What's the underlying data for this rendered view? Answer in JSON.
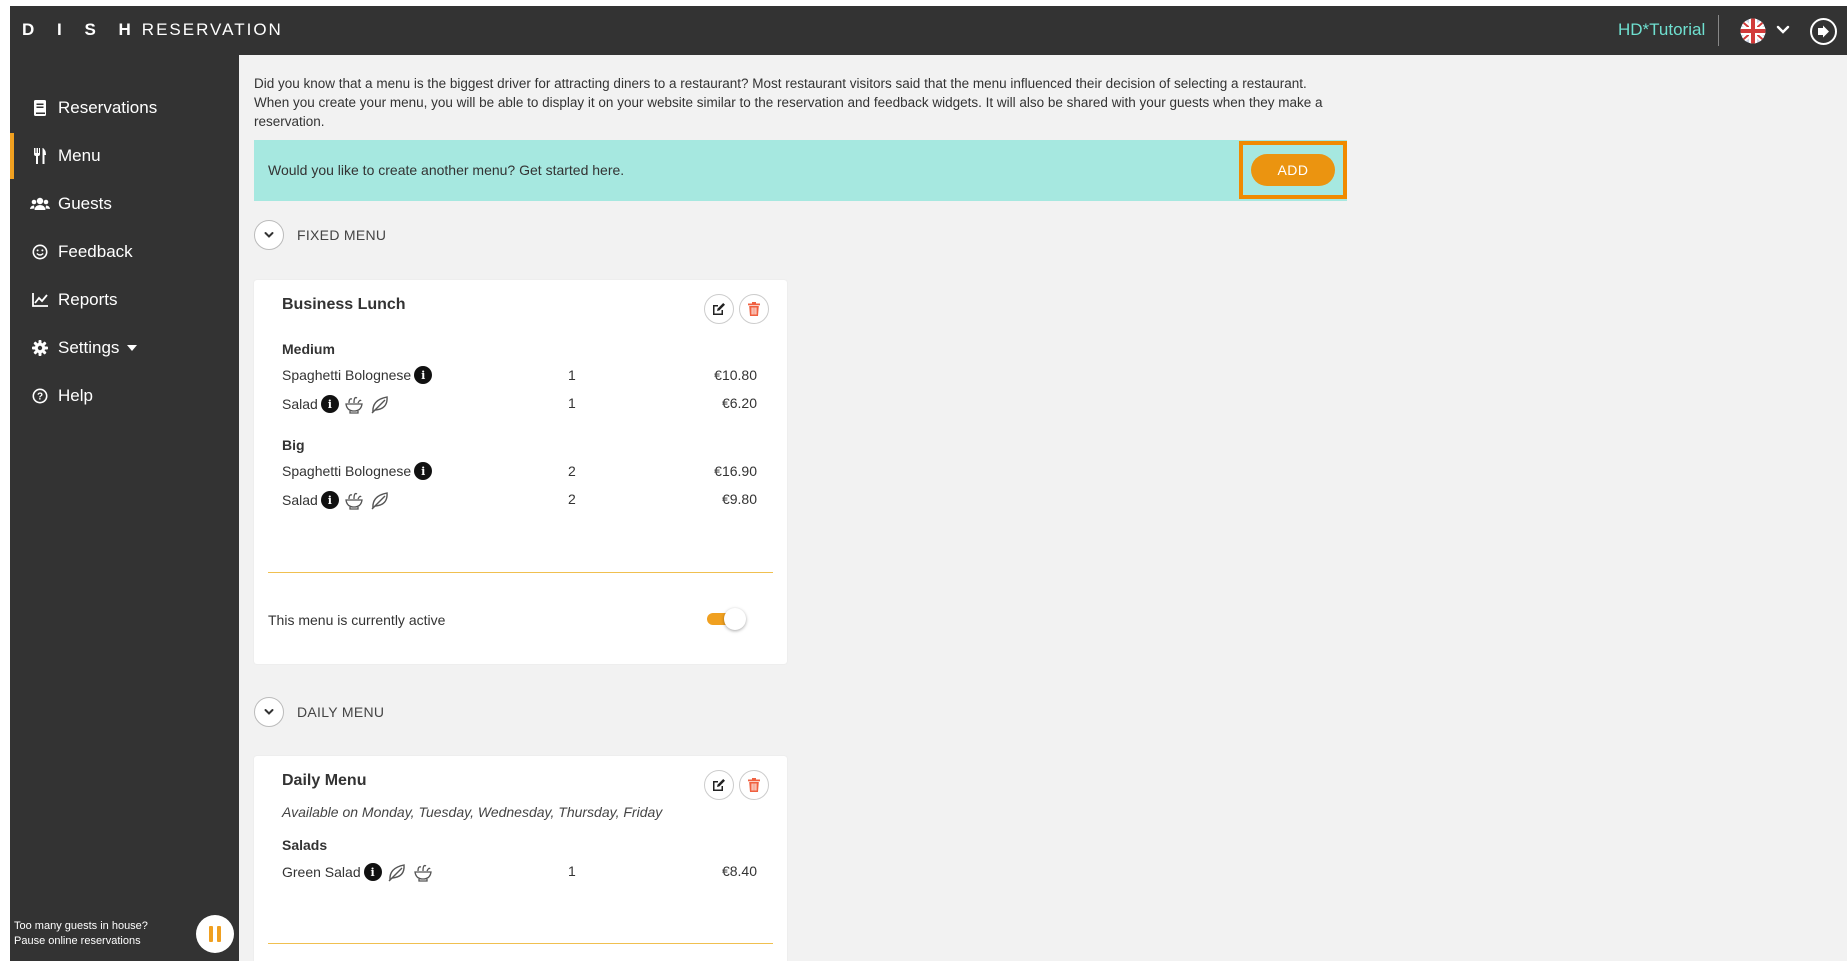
{
  "app": {
    "brand_bold": "D I S H",
    "brand_light": "RESERVATION"
  },
  "header": {
    "user_name": "HD*Tutorial",
    "language_icon": "uk-flag-icon",
    "logout_icon": "logout-icon"
  },
  "sidebar": {
    "items": [
      {
        "label": "Reservations",
        "icon": "book-icon"
      },
      {
        "label": "Menu",
        "icon": "utensils-icon",
        "active": true
      },
      {
        "label": "Guests",
        "icon": "users-icon"
      },
      {
        "label": "Feedback",
        "icon": "smile-icon"
      },
      {
        "label": "Reports",
        "icon": "chart-icon"
      },
      {
        "label": "Settings",
        "icon": "gear-icon"
      },
      {
        "label": "Help",
        "icon": "question-icon"
      }
    ],
    "pause_line1": "Too many guests in house?",
    "pause_line2": "Pause online reservations"
  },
  "main": {
    "intro": "Did you know that a menu is the biggest driver for attracting diners to a restaurant? Most restaurant visitors said that the menu influenced their decision of selecting a restaurant. When you create your menu, you will be able to display it on your website similar to the reservation and feedback widgets. It will also be shared with your guests when they make a reservation.",
    "banner_text": "Would you like to create another menu? Get started here.",
    "add_label": "ADD",
    "accent_color": "#eb9410",
    "banner_color": "#a6e8e0"
  },
  "fixed_menu": {
    "section_title": "FIXED MENU",
    "card": {
      "title": "Business Lunch",
      "groups": [
        {
          "name": "Medium",
          "items": [
            {
              "name": "Spaghetti Bolognese",
              "qty": "1",
              "price": "€10.80"
            },
            {
              "name": "Salad",
              "qty": "1",
              "price": "€6.20"
            }
          ]
        },
        {
          "name": "Big",
          "items": [
            {
              "name": "Spaghetti Bolognese",
              "qty": "2",
              "price": "€16.90"
            },
            {
              "name": "Salad",
              "qty": "2",
              "price": "€9.80"
            }
          ]
        }
      ],
      "active_text": "This menu is currently active",
      "active": true
    }
  },
  "daily_menu": {
    "section_title": "DAILY MENU",
    "card": {
      "title": "Daily Menu",
      "availability": "Available on Monday, Tuesday, Wednesday, Thursday, Friday",
      "groups": [
        {
          "name": "Salads",
          "items": [
            {
              "name": "Green Salad",
              "qty": "1",
              "price": "€8.40"
            }
          ]
        }
      ]
    }
  }
}
